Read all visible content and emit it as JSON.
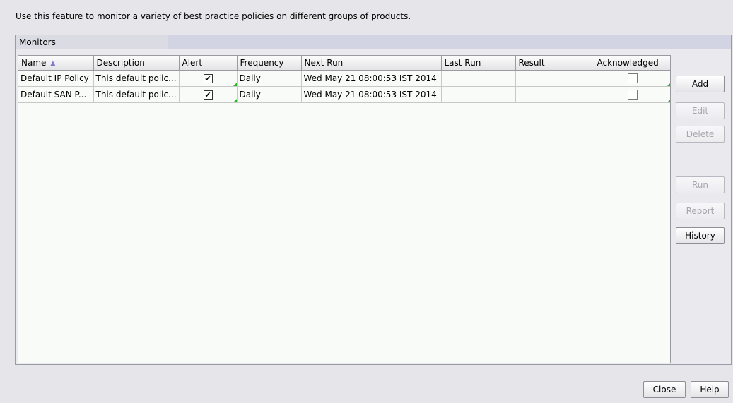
{
  "intro_text": "Use this feature to monitor a variety of best practice policies on different groups of products.",
  "panel": {
    "title": "Monitors",
    "columns": [
      "Name",
      "Description",
      "Alert",
      "Frequency",
      "Next Run",
      "Last Run",
      "Result",
      "Acknowledged"
    ],
    "sort_icon": "sort-ascending-icon",
    "rows": [
      {
        "name": "Default IP Policy",
        "description": "This default polic...",
        "alert": true,
        "frequency": "Daily",
        "next_run": "Wed May 21 08:00:53 IST 2014",
        "last_run": "",
        "result": "",
        "acknowledged": false
      },
      {
        "name": "Default SAN P...",
        "description": "This default polic...",
        "alert": true,
        "frequency": "Daily",
        "next_run": "Wed May 21 08:00:53 IST 2014",
        "last_run": "",
        "result": "",
        "acknowledged": false
      }
    ]
  },
  "side_buttons": {
    "add": "Add",
    "edit": "Edit",
    "delete": "Delete",
    "run": "Run",
    "report": "Report",
    "history": "History"
  },
  "footer": {
    "close": "Close",
    "help": "Help"
  },
  "colors": {
    "background": "#e6e6ea",
    "table_background": "#f8fbf7",
    "edit_marker": "#28b828",
    "disabled_text": "#a6a6ae"
  },
  "check_mark": "✔"
}
